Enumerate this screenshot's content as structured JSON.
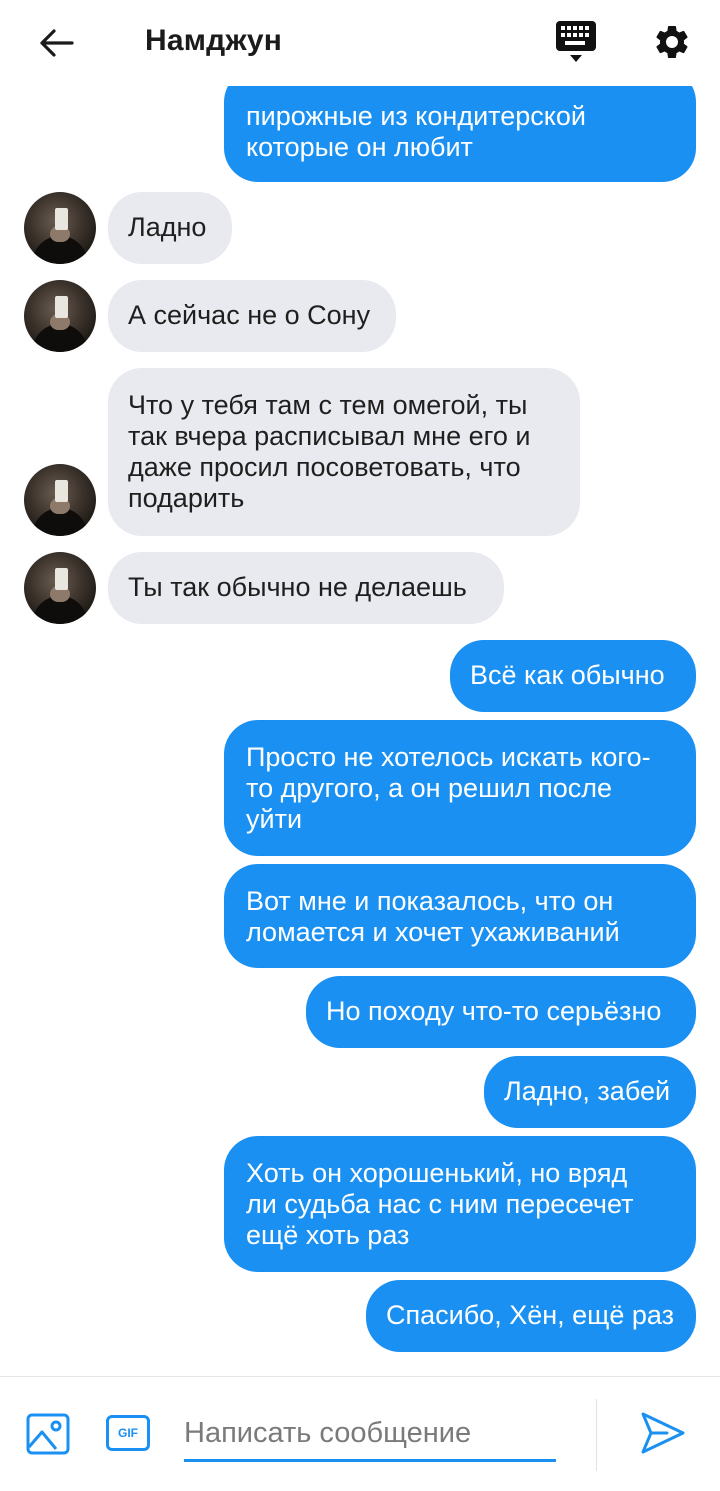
{
  "header": {
    "title": "Намджун"
  },
  "messages": [
    {
      "side": "out",
      "text": "пирожные из кондитерской\nкоторые он любит"
    },
    {
      "side": "in",
      "text": "Ладно"
    },
    {
      "side": "in",
      "text": "А сейчас не о Сону"
    },
    {
      "side": "in",
      "text": "Что у тебя там с тем омегой, ты\nтак вчера расписывал мне его и\nдаже просил посоветовать, что\nподарить"
    },
    {
      "side": "in",
      "text": "Ты так обычно не делаешь"
    },
    {
      "side": "out",
      "text": "Всё как обычно"
    },
    {
      "side": "out",
      "text": "Просто не хотелось искать кого-\nто другого, а он решил после\nуйти"
    },
    {
      "side": "out",
      "text": "Вот мне и показалось, что он\nломается и хочет ухаживаний"
    },
    {
      "side": "out",
      "text": "Но походу что-то серьёзно"
    },
    {
      "side": "out",
      "text": "Ладно, забей"
    },
    {
      "side": "out",
      "text": "Хоть он хорошенький, но вряд\nли судьба нас с ним пересечет\nещё хоть раз"
    },
    {
      "side": "out",
      "text": "Спасибо, Хён, ещё раз"
    }
  ],
  "composer": {
    "gif_label": "GIF",
    "placeholder": "Написать сообщение"
  },
  "icons": {
    "back": "arrow-left-icon",
    "keyboard": "keyboard-icon",
    "settings": "gear-icon",
    "image": "image-icon",
    "gif": "gif-icon",
    "send": "send-icon"
  },
  "colors": {
    "accent": "#1a91f2",
    "incoming_bubble": "#e8eaef",
    "outgoing_text": "#ffffff",
    "incoming_text": "#1f1f1f"
  }
}
